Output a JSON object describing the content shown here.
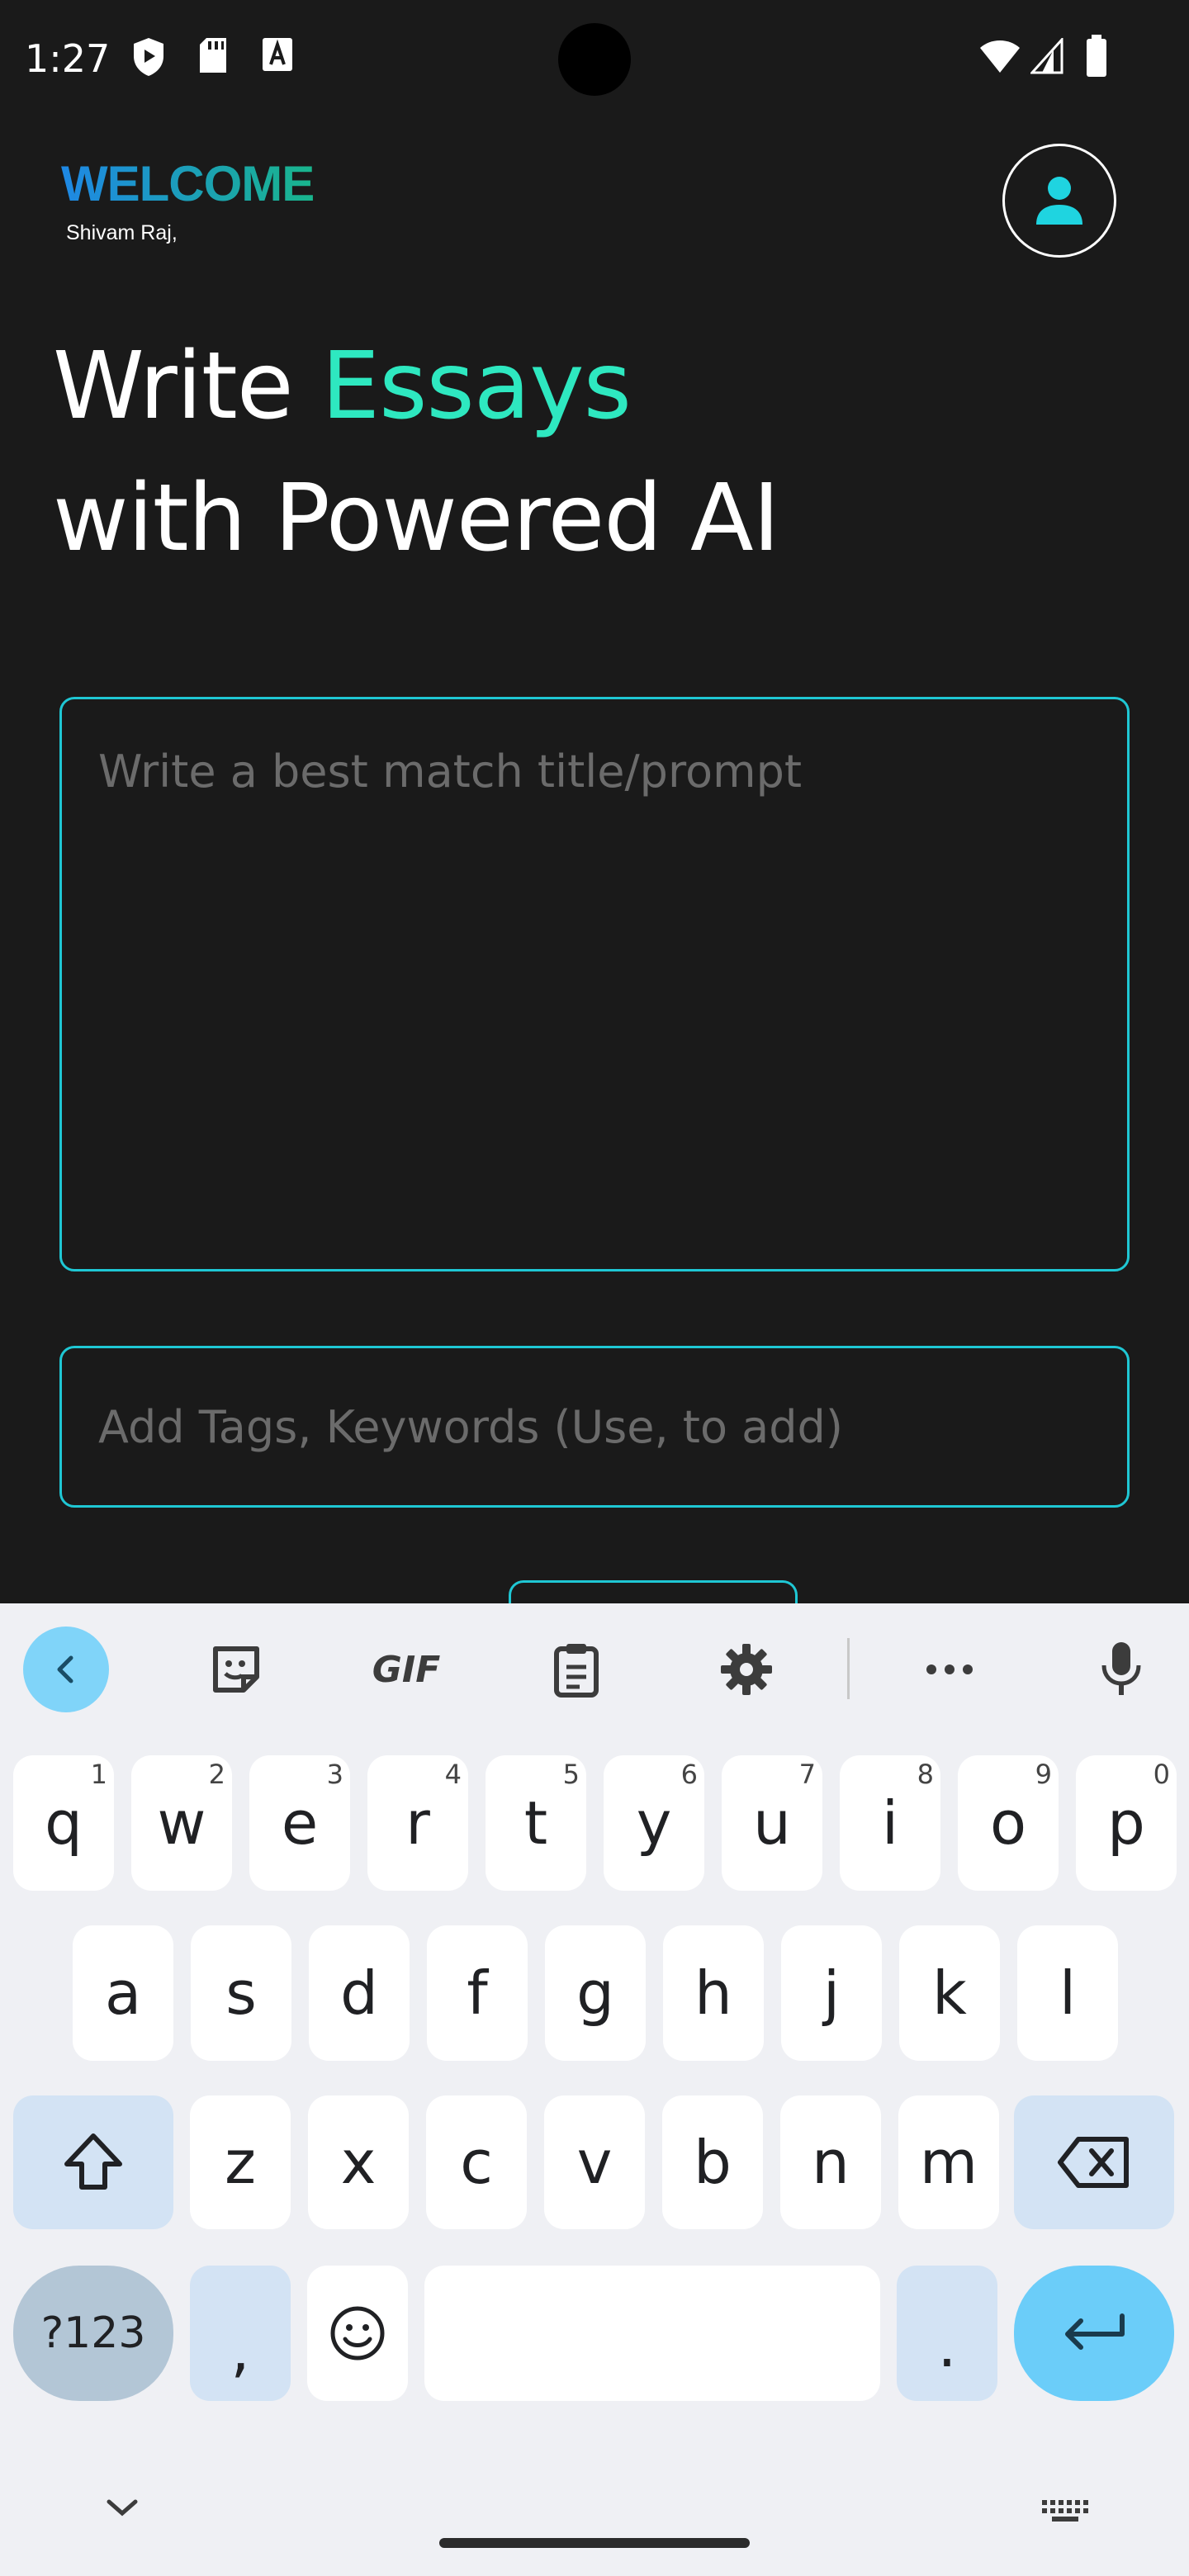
{
  "status_bar": {
    "time": "1:27"
  },
  "header": {
    "welcome": "WELCOME",
    "user_name": "Shivam Raj,"
  },
  "headline": {
    "line1_prefix": "Write ",
    "line1_accent": "Essays",
    "line2": "with Powered AI"
  },
  "prompt_input": {
    "placeholder": "Write a best match title/prompt",
    "value": ""
  },
  "tags_input": {
    "placeholder": "Add Tags, Keywords (Use, to add)",
    "value": ""
  },
  "keyboard": {
    "toolbar": [
      "back-icon",
      "sticker-icon",
      "gif-icon",
      "clipboard-icon",
      "settings-icon",
      "more-icon",
      "mic-icon"
    ],
    "gif_label": "GIF",
    "row1": [
      {
        "k": "q",
        "h": "1"
      },
      {
        "k": "w",
        "h": "2"
      },
      {
        "k": "e",
        "h": "3"
      },
      {
        "k": "r",
        "h": "4"
      },
      {
        "k": "t",
        "h": "5"
      },
      {
        "k": "y",
        "h": "6"
      },
      {
        "k": "u",
        "h": "7"
      },
      {
        "k": "i",
        "h": "8"
      },
      {
        "k": "o",
        "h": "9"
      },
      {
        "k": "p",
        "h": "0"
      }
    ],
    "row2": [
      "a",
      "s",
      "d",
      "f",
      "g",
      "h",
      "j",
      "k",
      "l"
    ],
    "row3": [
      "z",
      "x",
      "c",
      "v",
      "b",
      "n",
      "m"
    ],
    "sym_label": "?123",
    "comma": ",",
    "period": "."
  },
  "colors": {
    "accent": "#2ee8c0",
    "border": "#1fc7d4",
    "background": "#1a1a1a"
  }
}
